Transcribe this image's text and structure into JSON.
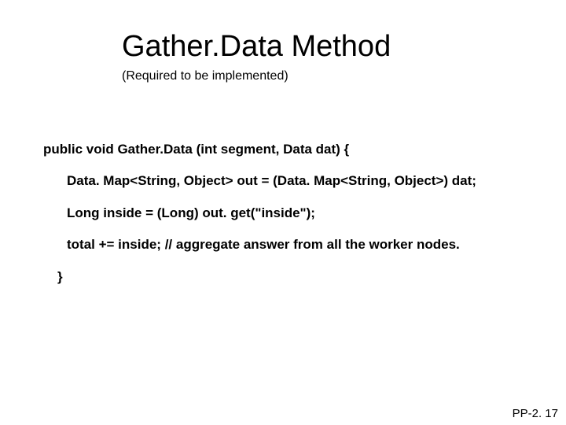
{
  "slide": {
    "title": "Gather.Data Method",
    "subtitle": "(Required to be implemented)",
    "code": {
      "line1": "public void Gather.Data (int segment, Data dat) {",
      "line2": "Data. Map<String, Object> out = (Data. Map<String, Object>) dat;",
      "line3": "Long inside = (Long) out. get(\"inside\");",
      "line4": "total += inside; // aggregate answer from all the worker nodes.",
      "line5": "}"
    },
    "page_number": "PP-2. 17"
  }
}
